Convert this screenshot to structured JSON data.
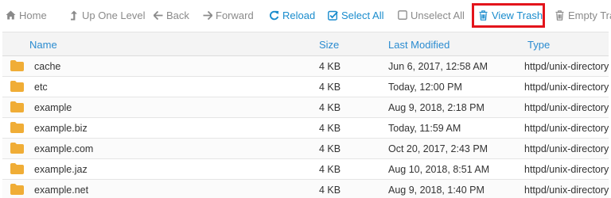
{
  "toolbar": {
    "home": "Home",
    "up_one_level": "Up One Level",
    "back": "Back",
    "forward": "Forward",
    "reload": "Reload",
    "select_all": "Select All",
    "unselect_all": "Unselect All",
    "view_trash": "View Trash",
    "empty_trash": "Empty Tra"
  },
  "table": {
    "headers": {
      "name": "Name",
      "size": "Size",
      "modified": "Last Modified",
      "type": "Type"
    },
    "rows": [
      {
        "name": "cache",
        "size": "4 KB",
        "modified": "Jun 6, 2017, 12:58 AM",
        "type": "httpd/unix-directory"
      },
      {
        "name": "etc",
        "size": "4 KB",
        "modified": "Today, 12:00 PM",
        "type": "httpd/unix-directory"
      },
      {
        "name": "example",
        "size": "4 KB",
        "modified": "Aug 9, 2018, 2:18 PM",
        "type": "httpd/unix-directory"
      },
      {
        "name": "example.biz",
        "size": "4 KB",
        "modified": "Today, 11:59 AM",
        "type": "httpd/unix-directory"
      },
      {
        "name": "example.com",
        "size": "4 KB",
        "modified": "Oct 20, 2017, 2:43 PM",
        "type": "httpd/unix-directory"
      },
      {
        "name": "example.jaz",
        "size": "4 KB",
        "modified": "Aug 10, 2018, 8:51 AM",
        "type": "httpd/unix-directory"
      },
      {
        "name": "example.net",
        "size": "4 KB",
        "modified": "Aug 9, 2018, 1:40 PM",
        "type": "httpd/unix-directory"
      }
    ]
  },
  "colors": {
    "accent": "#1a8ccd",
    "muted": "#8a8a8a",
    "highlight": "#e3141b",
    "folder": "#f0ad36"
  },
  "icons": {
    "home": "home-icon",
    "up_one_level": "level-up-icon",
    "back": "arrow-left-icon",
    "forward": "arrow-right-icon",
    "reload": "refresh-icon",
    "select_all": "checked-box-icon",
    "unselect_all": "empty-box-icon",
    "view_trash": "trash-icon",
    "empty_trash": "trash-icon",
    "row": "folder-icon"
  }
}
